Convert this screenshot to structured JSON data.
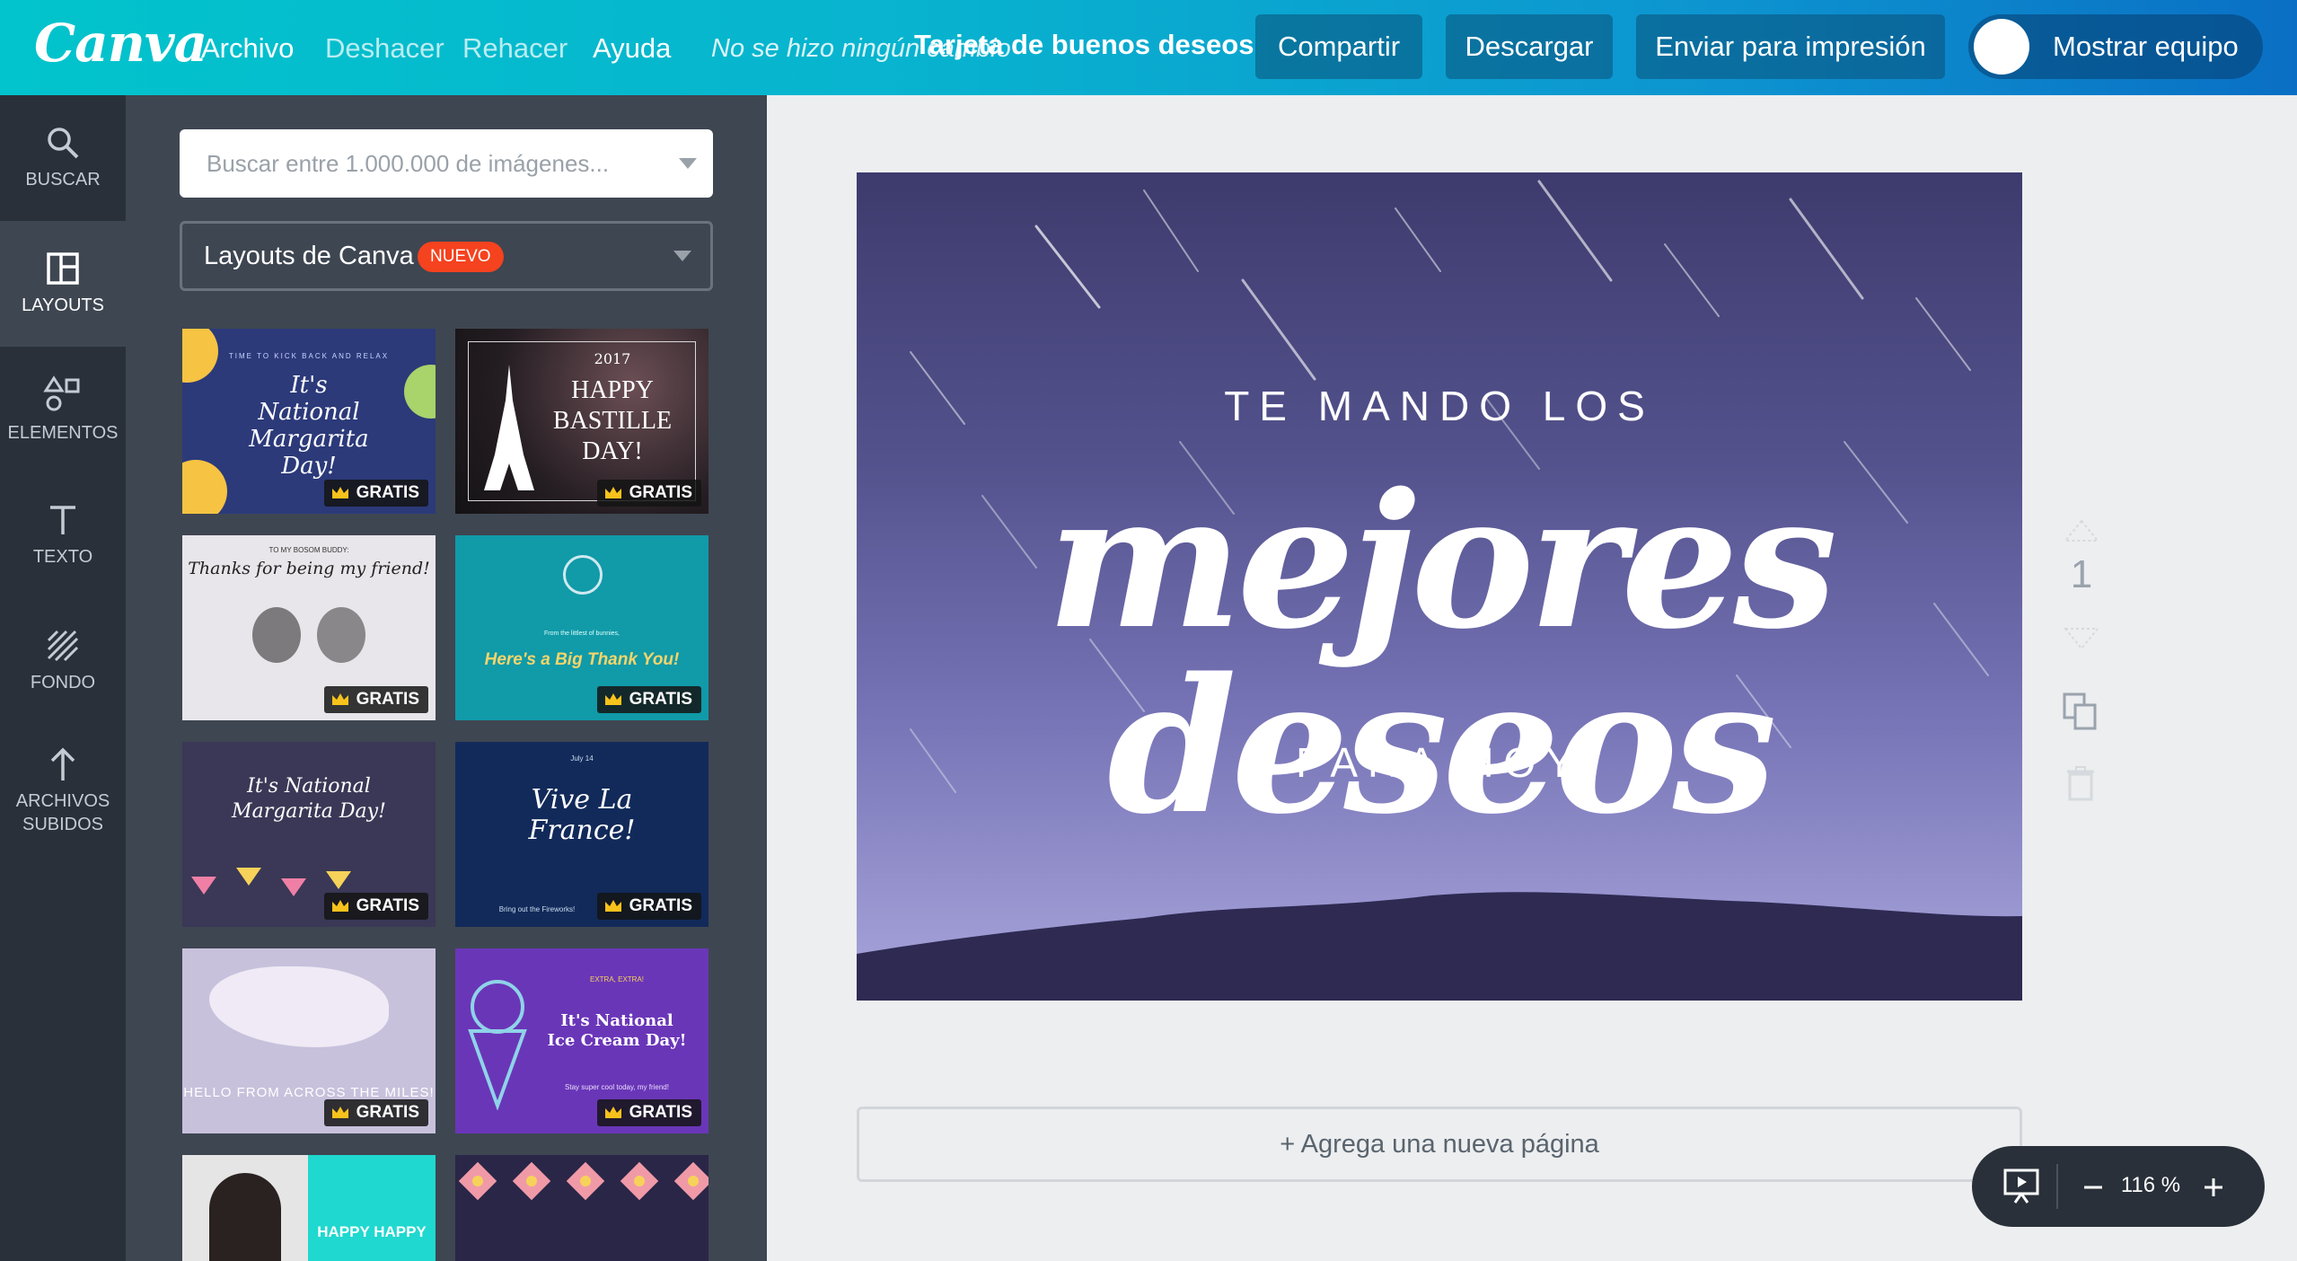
{
  "topbar": {
    "logo": "Canva",
    "menu": [
      "Archivo",
      "Deshacer",
      "Rehacer",
      "Ayuda"
    ],
    "status": "No se hizo ningún cambio",
    "doc_title": "Tarjeta de buenos deseos",
    "buttons": {
      "share": "Compartir",
      "download": "Descargar",
      "print": "Enviar para impresión"
    },
    "team_label": "Mostrar equipo"
  },
  "leftnav": {
    "items": [
      {
        "label": "BUSCAR",
        "icon": "search-icon"
      },
      {
        "label": "LAYOUTS",
        "icon": "layouts-icon"
      },
      {
        "label": "ELEMENTOS",
        "icon": "elements-icon"
      },
      {
        "label": "TEXTO",
        "icon": "text-icon"
      },
      {
        "label": "FONDO",
        "icon": "background-icon"
      },
      {
        "label": "ARCHIVOS SUBIDOS",
        "icon": "upload-icon"
      }
    ]
  },
  "panel": {
    "search_placeholder": "Buscar entre 1.000.000 de imágenes...",
    "layouts_label": "Layouts de Canva",
    "new_badge": "NUEVO",
    "free_label": "GRATIS",
    "thumbs": [
      {
        "title": "It's National Margarita Day!",
        "top": "TIME TO KICK BACK AND RELAX"
      },
      {
        "year": "2017",
        "title": "HAPPY BASTILLE DAY!"
      },
      {
        "top": "TO MY BOSOM BUDDY:",
        "title": "Thanks for being my friend!"
      },
      {
        "top": "From the littlest of bunnies,",
        "title": "Here's a Big Thank You!"
      },
      {
        "title": "It's National Margarita Day!"
      },
      {
        "top": "July 14",
        "title": "Vive La France!",
        "bottom": "Bring out the Fireworks!"
      },
      {
        "title": "HELLO FROM ACROSS THE MILES!"
      },
      {
        "top": "EXTRA, EXTRA!",
        "title": "It's National Ice Cream Day!",
        "bottom": "Stay super cool today, my friend!"
      },
      {
        "title": "HAPPY HAPPY"
      },
      {
        "title": ""
      }
    ]
  },
  "card": {
    "line1": "TE MANDO LOS",
    "script": "mejores deseos",
    "line3": "PARA HOY"
  },
  "editor": {
    "page_number": "1",
    "add_page": "+ Agrega una nueva página",
    "zoom": "116 %"
  },
  "colors": {
    "accent": "#00c4cc",
    "brand_dark": "#293039",
    "panel": "#3e4651",
    "badge": "#f5421f"
  }
}
